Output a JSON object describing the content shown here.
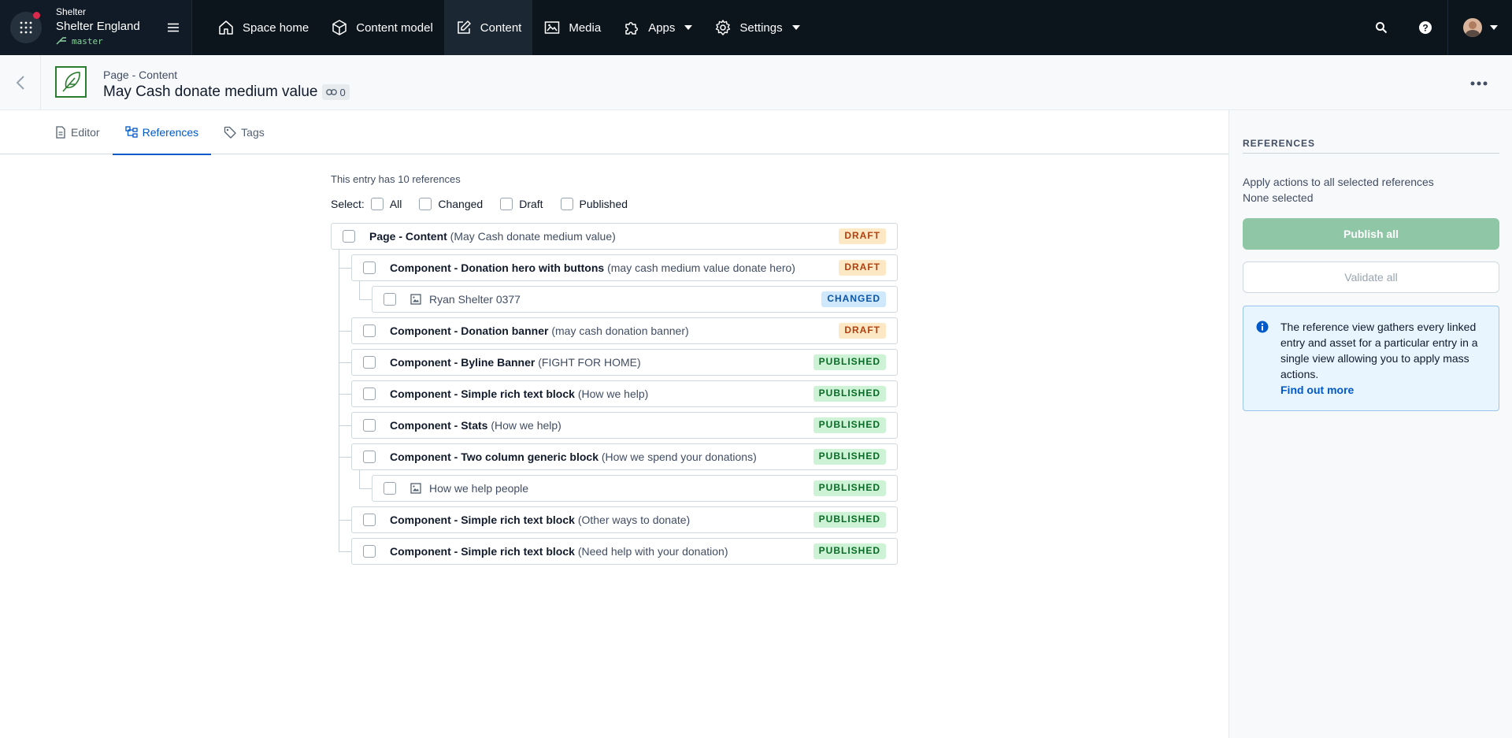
{
  "topbar": {
    "org_name": "Shelter",
    "space_name": "Shelter England",
    "environment": "master",
    "nav": [
      {
        "label": "Space home",
        "icon": "home-icon"
      },
      {
        "label": "Content model",
        "icon": "cube-icon"
      },
      {
        "label": "Content",
        "icon": "edit-icon",
        "active": true
      },
      {
        "label": "Media",
        "icon": "image-icon"
      },
      {
        "label": "Apps",
        "icon": "puzzle-icon",
        "dropdown": true
      },
      {
        "label": "Settings",
        "icon": "gear-icon",
        "dropdown": true
      }
    ]
  },
  "header": {
    "content_type": "Page - Content",
    "title": "May Cash donate medium value",
    "reference_count": "0"
  },
  "tabs": [
    {
      "label": "Editor",
      "icon": "document-icon"
    },
    {
      "label": "References",
      "icon": "references-icon",
      "active": true
    },
    {
      "label": "Tags",
      "icon": "tag-icon"
    }
  ],
  "references": {
    "summary": "This entry has 10 references",
    "select_label": "Select:",
    "filters": [
      "All",
      "Changed",
      "Draft",
      "Published"
    ],
    "items": [
      {
        "level": 0,
        "title": "Page - Content",
        "detail": "(May Cash donate medium value)",
        "status": "DRAFT",
        "type": "entry"
      },
      {
        "level": 1,
        "title": "Component - Donation hero with buttons",
        "detail": "(may cash medium value donate hero)",
        "status": "DRAFT",
        "type": "entry"
      },
      {
        "level": 2,
        "title": "",
        "detail": "Ryan Shelter 0377",
        "status": "CHANGED",
        "type": "asset"
      },
      {
        "level": 1,
        "title": "Component - Donation banner",
        "detail": "(may cash donation banner)",
        "status": "DRAFT",
        "type": "entry"
      },
      {
        "level": 1,
        "title": "Component - Byline Banner",
        "detail": "(FIGHT FOR HOME)",
        "status": "PUBLISHED",
        "type": "entry"
      },
      {
        "level": 1,
        "title": "Component - Simple rich text block",
        "detail": "(How we help)",
        "status": "PUBLISHED",
        "type": "entry"
      },
      {
        "level": 1,
        "title": "Component - Stats",
        "detail": "(How we help)",
        "status": "PUBLISHED",
        "type": "entry"
      },
      {
        "level": 1,
        "title": "Component - Two column generic block",
        "detail": "(How we spend your donations)",
        "status": "PUBLISHED",
        "type": "entry"
      },
      {
        "level": 2,
        "title": "",
        "detail": "How we help people",
        "status": "PUBLISHED",
        "type": "asset"
      },
      {
        "level": 1,
        "title": "Component - Simple rich text block",
        "detail": "(Other ways to donate)",
        "status": "PUBLISHED",
        "type": "entry"
      },
      {
        "level": 1,
        "title": "Component - Simple rich text block",
        "detail": "(Need help with your donation)",
        "status": "PUBLISHED",
        "type": "entry"
      }
    ]
  },
  "sidebar": {
    "heading": "REFERENCES",
    "description": "Apply actions to all selected references",
    "selection_status": "None selected",
    "publish_button": "Publish all",
    "validate_button": "Validate all",
    "info_text": "The reference view gathers every linked entry and asset for a particular entry in a single view allowing you to apply mass actions.",
    "info_link": "Find out more"
  },
  "colors": {
    "nav_bg": "#0c141c",
    "accent": "#0059c8",
    "draft": "#b2400e",
    "changed": "#0a55a5",
    "published": "#086b25",
    "publish_button": "#8fc7a6"
  }
}
